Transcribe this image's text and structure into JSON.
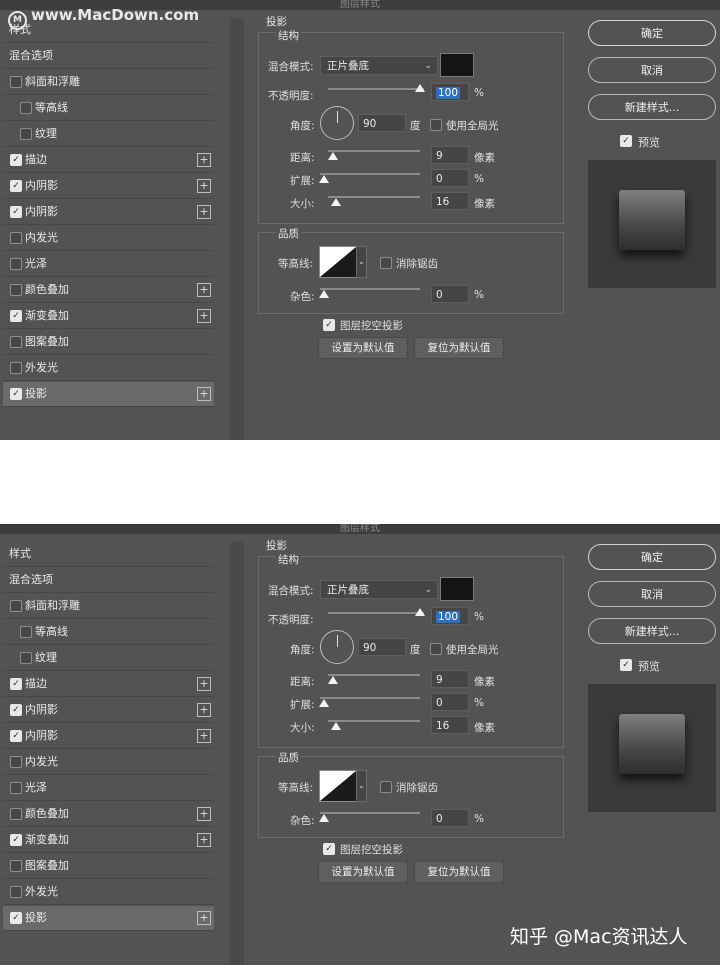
{
  "watermark": "www.MacDown.com",
  "caption": "知乎 @Mac资讯达人",
  "dialog_title": "图层样式",
  "left": {
    "header": "样式",
    "blend_options": "混合选项",
    "items": [
      {
        "label": "斜面和浮雕",
        "checked": false,
        "plus": false,
        "sub": false
      },
      {
        "label": "等高线",
        "checked": false,
        "plus": false,
        "sub": true
      },
      {
        "label": "纹理",
        "checked": false,
        "plus": false,
        "sub": true
      },
      {
        "label": "描边",
        "checked": true,
        "plus": true,
        "sub": false
      },
      {
        "label": "内阴影",
        "checked": true,
        "plus": true,
        "sub": false
      },
      {
        "label": "内阴影",
        "checked": true,
        "plus": true,
        "sub": false
      },
      {
        "label": "内发光",
        "checked": false,
        "plus": false,
        "sub": false
      },
      {
        "label": "光泽",
        "checked": false,
        "plus": false,
        "sub": false
      },
      {
        "label": "颜色叠加",
        "checked": false,
        "plus": true,
        "sub": false
      },
      {
        "label": "渐变叠加",
        "checked": true,
        "plus": true,
        "sub": false
      },
      {
        "label": "图案叠加",
        "checked": false,
        "plus": false,
        "sub": false
      },
      {
        "label": "外发光",
        "checked": false,
        "plus": false,
        "sub": false
      },
      {
        "label": "投影",
        "checked": true,
        "plus": true,
        "sub": false,
        "selected": true
      }
    ]
  },
  "drop_shadow": {
    "title": "投影",
    "structure": "结构",
    "blend_mode_label": "混合模式:",
    "blend_mode": "正片叠底",
    "shadow_color": "#141414",
    "opacity_label": "不透明度:",
    "opacity": "100",
    "opacity_percent": 1.0,
    "percent_unit": "%",
    "angle_label": "角度:",
    "angle": "90",
    "degree_unit": "度",
    "global_light": "使用全局光",
    "distance_label": "距离:",
    "distance": "9",
    "spread_label": "扩展:",
    "spread": "0",
    "size_label": "大小:",
    "size": "16",
    "px_unit": "像素",
    "quality": "品质",
    "contour_label": "等高线:",
    "antialias": "消除锯齿",
    "noise_label": "杂色:",
    "noise": "0",
    "knockout": "图层挖空投影",
    "set_default": "设置为默认值",
    "reset_default": "复位为默认值"
  },
  "right": {
    "ok": "确定",
    "cancel": "取消",
    "new_style": "新建样式...",
    "preview": "预览"
  }
}
